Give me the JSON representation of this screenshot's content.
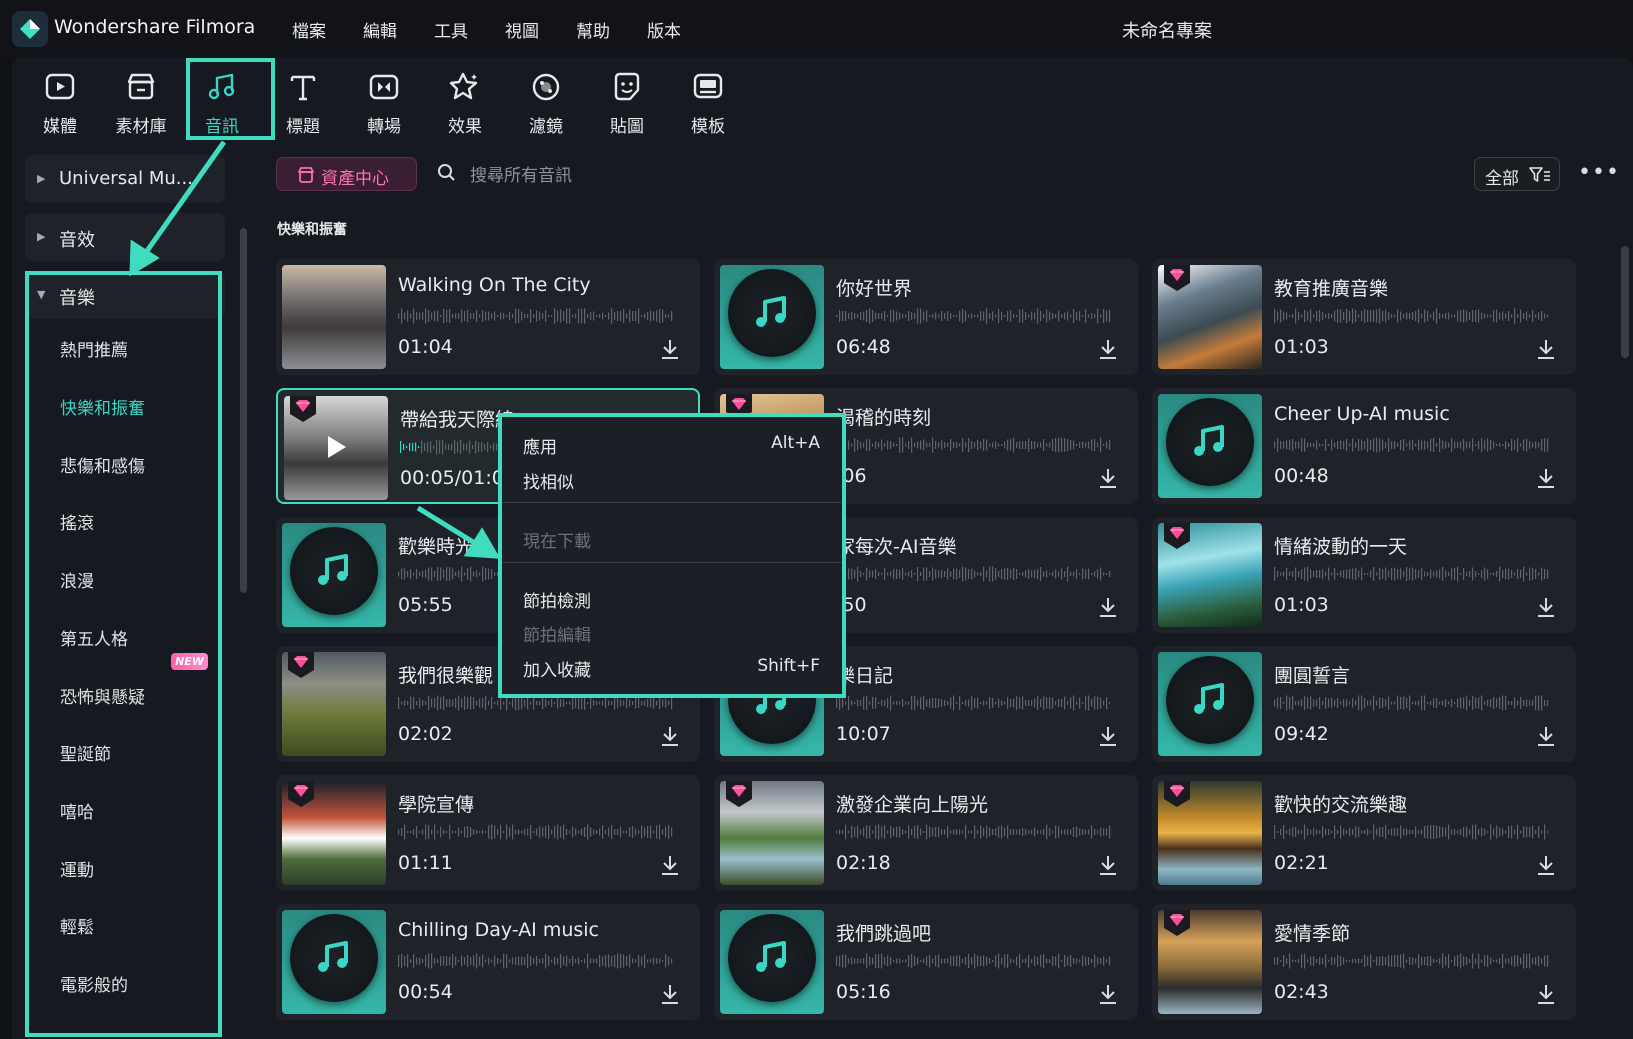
{
  "app": {
    "name": "Wondershare Filmora",
    "project_title": "未命名專案"
  },
  "menu": [
    "檔案",
    "編輯",
    "工具",
    "視圖",
    "幫助",
    "版本"
  ],
  "toolbar": [
    {
      "label": "媒體",
      "icon": "media-icon"
    },
    {
      "label": "素材庫",
      "icon": "stock-library-icon"
    },
    {
      "label": "音訊",
      "icon": "music-note-icon",
      "active": true
    },
    {
      "label": "標題",
      "icon": "title-text-icon"
    },
    {
      "label": "轉場",
      "icon": "transition-icon"
    },
    {
      "label": "效果",
      "icon": "effects-icon"
    },
    {
      "label": "濾鏡",
      "icon": "filter-icon"
    },
    {
      "label": "貼圖",
      "icon": "sticker-icon"
    },
    {
      "label": "模板",
      "icon": "template-icon"
    }
  ],
  "sidebar": {
    "sections": [
      {
        "label": "Universal Mu...",
        "expanded": false
      },
      {
        "label": "音效",
        "expanded": false
      },
      {
        "label": "音樂",
        "expanded": true
      }
    ],
    "categories": [
      {
        "label": "熱門推薦"
      },
      {
        "label": "快樂和振奮",
        "selected": true
      },
      {
        "label": "悲傷和感傷"
      },
      {
        "label": "搖滾"
      },
      {
        "label": "浪漫"
      },
      {
        "label": "第五人格",
        "badge": "NEW"
      },
      {
        "label": "恐怖與懸疑"
      },
      {
        "label": "聖誕節"
      },
      {
        "label": "嘻哈"
      },
      {
        "label": "運動"
      },
      {
        "label": "輕鬆"
      },
      {
        "label": "電影般的"
      }
    ]
  },
  "main": {
    "asset_center_label": "資產中心",
    "search_placeholder": "搜尋所有音訊",
    "filter_label": "全部",
    "section_title": "快樂和振奮",
    "tracks": [
      {
        "title": "Walking On The City",
        "duration": "01:04",
        "thumb": "photo",
        "premium": false
      },
      {
        "title": "你好世界",
        "duration": "06:48",
        "thumb": "disc",
        "premium": false
      },
      {
        "title": "教育推廣音樂",
        "duration": "01:03",
        "thumb": "photo",
        "premium": true
      },
      {
        "title": "帶給我天際線",
        "duration": "00:05/01:00",
        "thumb": "photo",
        "premium": true,
        "playing": true
      },
      {
        "title": "渴稽的時刻",
        "duration": ":06",
        "thumb": "photo",
        "premium": true
      },
      {
        "title": "Cheer Up-AI music",
        "duration": "00:48",
        "thumb": "disc",
        "premium": false
      },
      {
        "title": "歡樂時光",
        "duration": "05:55",
        "thumb": "disc",
        "premium": false
      },
      {
        "title": "家每次-AI音樂",
        "duration": ":50",
        "thumb": "disc",
        "premium": false
      },
      {
        "title": "情緒波動的一天",
        "duration": "01:03",
        "thumb": "photo",
        "premium": true
      },
      {
        "title": "我們很樂觀",
        "duration": "02:02",
        "thumb": "photo",
        "premium": true
      },
      {
        "title": "樂日記",
        "duration": "10:07",
        "thumb": "disc",
        "premium": false
      },
      {
        "title": "團圓誓言",
        "duration": "09:42",
        "thumb": "disc",
        "premium": false
      },
      {
        "title": "學院宣傳",
        "duration": "01:11",
        "thumb": "photo",
        "premium": true
      },
      {
        "title": "激發企業向上陽光",
        "duration": "02:18",
        "thumb": "photo",
        "premium": true
      },
      {
        "title": "歡快的交流樂趣",
        "duration": "02:21",
        "thumb": "photo",
        "premium": true
      },
      {
        "title": "Chilling Day-AI music",
        "duration": "00:54",
        "thumb": "disc",
        "premium": false
      },
      {
        "title": "我們跳過吧",
        "duration": "05:16",
        "thumb": "disc",
        "premium": false
      },
      {
        "title": "愛情季節",
        "duration": "02:43",
        "thumb": "photo",
        "premium": true
      }
    ]
  },
  "context_menu": [
    {
      "label": "應用",
      "shortcut": "Alt+A",
      "enabled": true
    },
    {
      "label": "找相似",
      "shortcut": "",
      "enabled": true
    },
    {
      "label": "現在下載",
      "shortcut": "",
      "enabled": false
    },
    {
      "label": "節拍檢測",
      "shortcut": "",
      "enabled": true
    },
    {
      "label": "節拍編輯",
      "shortcut": "",
      "enabled": false
    },
    {
      "label": "加入收藏",
      "shortcut": "Shift+F",
      "enabled": true
    }
  ],
  "colors": {
    "accent": "#38d6c4",
    "annotation": "#3fdcc0",
    "premium": "#ff4f9a",
    "background": "#16191f",
    "card": "#1f2329"
  }
}
